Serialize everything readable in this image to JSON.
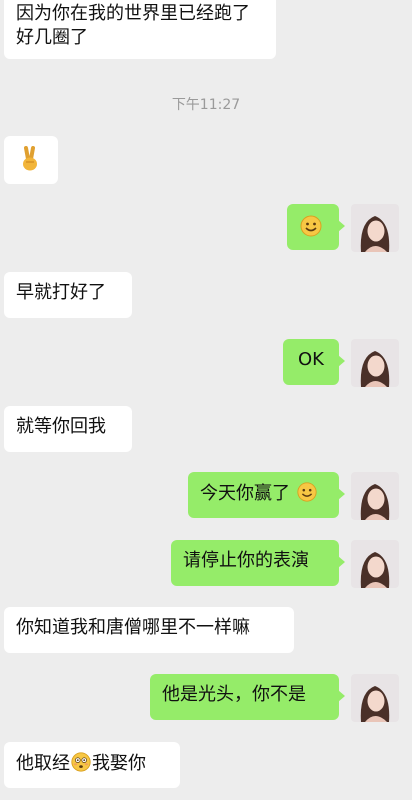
{
  "timestamp": "下午11:27",
  "messages": [
    {
      "side": "left",
      "text": "因为你在我的世界里已经跑了好几圈了"
    },
    {
      "side": "left",
      "icon": "victory-hand-emoji"
    },
    {
      "side": "right",
      "icon": "smile-emoji"
    },
    {
      "side": "left",
      "text": "早就打好了"
    },
    {
      "side": "right",
      "text": "OK"
    },
    {
      "side": "left",
      "text": "就等你回我"
    },
    {
      "side": "right",
      "text": "今天你赢了",
      "icon": "smile-emoji"
    },
    {
      "side": "right",
      "text": "请停止你的表演"
    },
    {
      "side": "left",
      "text": "你知道我和唐僧哪里不一样嘛"
    },
    {
      "side": "right",
      "text": "他是光头，你不是"
    },
    {
      "side": "left",
      "text_before": "他取经",
      "icon": "flushed-emoji",
      "text_after": "我娶你"
    }
  ]
}
